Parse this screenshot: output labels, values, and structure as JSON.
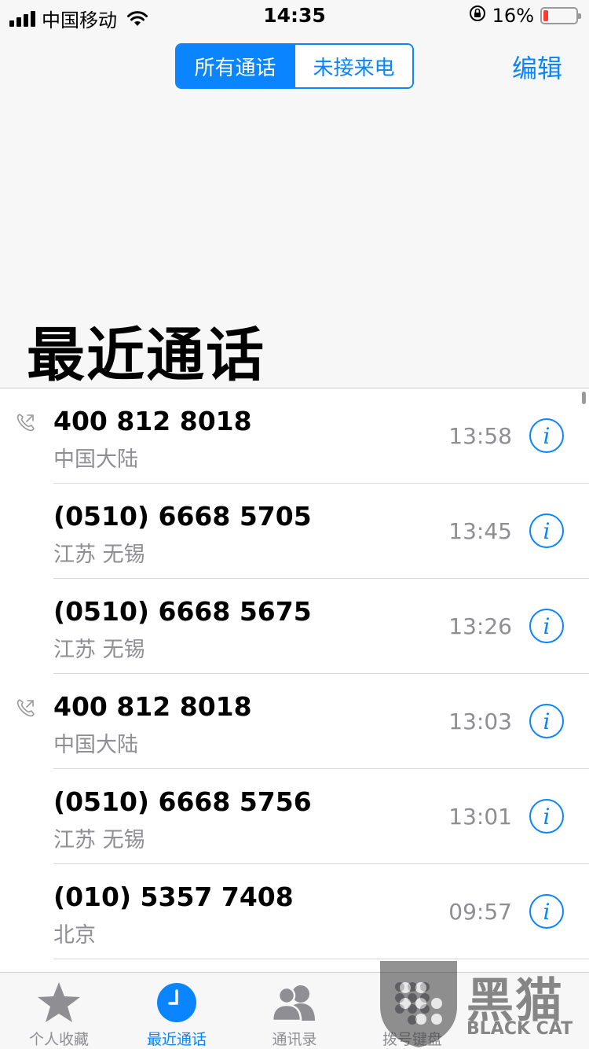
{
  "status_bar": {
    "carrier": "中国移动",
    "time": "14:35",
    "battery_percent": "16%",
    "battery_level": 0.16,
    "battery_color": "#ff3b30"
  },
  "header": {
    "segments": [
      {
        "label": "所有通话",
        "active": true
      },
      {
        "label": "未接来电",
        "active": false
      }
    ],
    "edit_label": "编辑",
    "title": "最近通话"
  },
  "colors": {
    "accent": "#0a84ff",
    "secondary_text": "#8e8e93"
  },
  "calls": [
    {
      "number": "400 812 8018",
      "location": "中国大陆",
      "time": "13:58",
      "outgoing": true
    },
    {
      "number": "(0510) 6668 5705",
      "location": "江苏 无锡",
      "time": "13:45",
      "outgoing": false
    },
    {
      "number": "(0510) 6668 5675",
      "location": "江苏 无锡",
      "time": "13:26",
      "outgoing": false
    },
    {
      "number": "400 812 8018",
      "location": "中国大陆",
      "time": "13:03",
      "outgoing": true
    },
    {
      "number": "(0510) 6668 5756",
      "location": "江苏 无锡",
      "time": "13:01",
      "outgoing": false
    },
    {
      "number": "(010) 5357 7408",
      "location": "北京",
      "time": "09:57",
      "outgoing": false
    }
  ],
  "info_glyph": "i",
  "tabs": [
    {
      "label": "个人收藏",
      "icon": "star-icon",
      "active": false
    },
    {
      "label": "最近通话",
      "icon": "clock-icon",
      "active": true
    },
    {
      "label": "通讯录",
      "icon": "contacts-icon",
      "active": false
    },
    {
      "label": "拨号键盘",
      "icon": "keypad-icon",
      "active": false
    }
  ],
  "watermark": {
    "brand": "黑猫",
    "sub": "BLACK CAT"
  }
}
